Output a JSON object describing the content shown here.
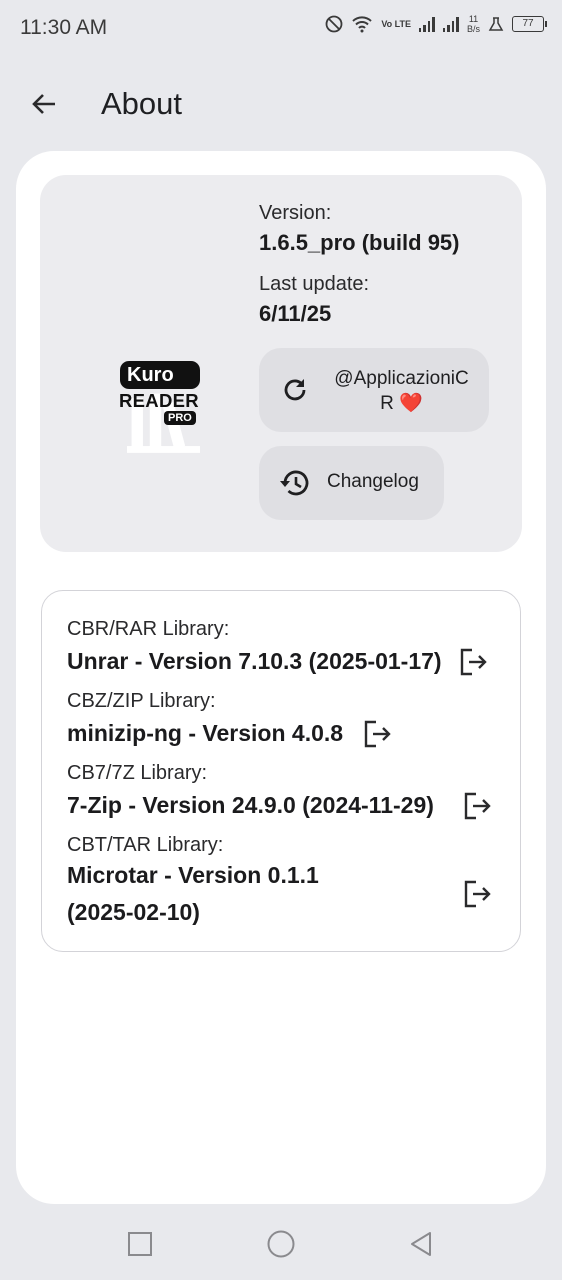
{
  "status_bar": {
    "time": "11:30 AM",
    "network": "Vo LTE",
    "speed_value": "11",
    "speed_unit": "B/s",
    "battery": "77"
  },
  "header": {
    "title": "About"
  },
  "app_info": {
    "logo_brand": "Kuro",
    "logo_product": "READER",
    "logo_tier": "PRO",
    "version_label": "Version:",
    "version_value": "1.6.5_pro (build 95)",
    "update_label": "Last update:",
    "update_value": "6/11/25",
    "author_button": "@ApplicazioniCR ❤️",
    "changelog_button": "Changelog"
  },
  "libraries": [
    {
      "label": "CBR/RAR Library:",
      "value": "Unrar - Version 7.10.3 (2025-01-17)"
    },
    {
      "label": "CBZ/ZIP Library:",
      "value": "minizip-ng - Version 4.0.8"
    },
    {
      "label": "CB7/7Z Library:",
      "value": "7-Zip - Version 24.9.0 (2024-11-29)"
    },
    {
      "label": "CBT/TAR Library:",
      "value": "Microtar - Version 0.1.1 (2025-02-10)"
    }
  ],
  "icons": {
    "back": "arrow-left-icon",
    "author": "refresh-icon",
    "changelog": "history-icon",
    "library_link": "exit-to-app-icon",
    "nav": [
      "square-icon",
      "circle-icon",
      "triangle-back-icon"
    ]
  },
  "colors": {
    "background": "#e8e9ed",
    "sheet": "#ffffff",
    "info_card": "#ececef",
    "pill": "#dfdfe3",
    "text": "#1b1b1d"
  }
}
